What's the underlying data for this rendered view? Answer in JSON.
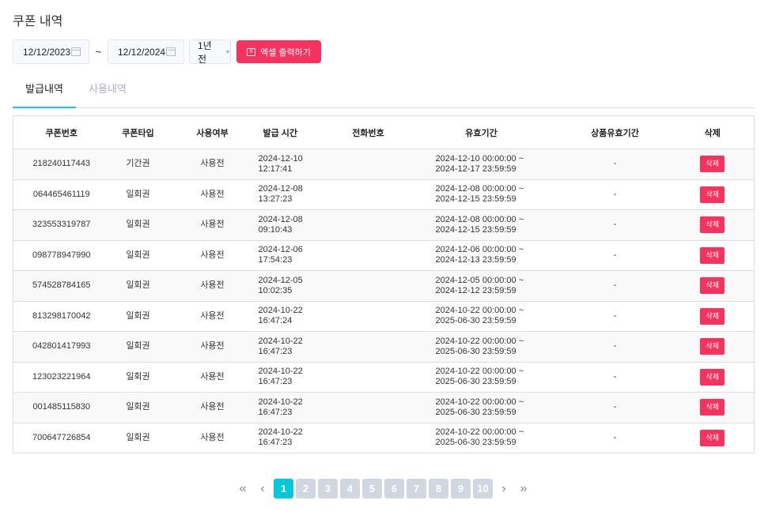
{
  "title": "쿠폰 내역",
  "filters": {
    "start_date": "12/12/2023",
    "separator": "~",
    "end_date": "12/12/2024",
    "period": "1년 전",
    "excel_label": "엑셀 출력하기"
  },
  "tabs": [
    {
      "label": "발급내역",
      "active": true
    },
    {
      "label": "사용내역",
      "active": false
    }
  ],
  "columns": [
    "쿠폰번호",
    "쿠폰타입",
    "사용여부",
    "발급 시간",
    "전화번호",
    "유효기간",
    "상품유효기간",
    "삭제"
  ],
  "rows": [
    {
      "no": "218240117443",
      "type": "기간권",
      "status": "사용전",
      "date": "2024-12-10",
      "time": "12:17:41",
      "phone": "",
      "valid_from": "2024-12-10 00:00:00 ~",
      "valid_to": "2024-12-17 23:59:59",
      "product_valid": "-",
      "del": "삭제"
    },
    {
      "no": "064465461119",
      "type": "일회권",
      "status": "사용전",
      "date": "2024-12-08",
      "time": "13:27:23",
      "phone": "",
      "valid_from": "2024-12-08 00:00:00 ~",
      "valid_to": "2024-12-15 23:59:59",
      "product_valid": "-",
      "del": "삭제"
    },
    {
      "no": "323553319787",
      "type": "일회권",
      "status": "사용전",
      "date": "2024-12-08",
      "time": "09:10:43",
      "phone": "",
      "valid_from": "2024-12-08 00:00:00 ~",
      "valid_to": "2024-12-15 23:59:59",
      "product_valid": "-",
      "del": "삭제"
    },
    {
      "no": "098778947990",
      "type": "일회권",
      "status": "사용전",
      "date": "2024-12-06",
      "time": "17:54:23",
      "phone": "",
      "valid_from": "2024-12-06 00:00:00 ~",
      "valid_to": "2024-12-13 23:59:59",
      "product_valid": "-",
      "del": "삭제"
    },
    {
      "no": "574528784165",
      "type": "일회권",
      "status": "사용전",
      "date": "2024-12-05",
      "time": "10:02:35",
      "phone": "",
      "valid_from": "2024-12-05 00:00:00 ~",
      "valid_to": "2024-12-12 23:59:59",
      "product_valid": "-",
      "del": "삭제"
    },
    {
      "no": "813298170042",
      "type": "일회권",
      "status": "사용전",
      "date": "2024-10-22",
      "time": "16:47:24",
      "phone": "",
      "valid_from": "2024-10-22 00:00:00 ~",
      "valid_to": "2025-06-30 23:59:59",
      "product_valid": "-",
      "del": "삭제"
    },
    {
      "no": "042801417993",
      "type": "일회권",
      "status": "사용전",
      "date": "2024-10-22",
      "time": "16:47:23",
      "phone": "",
      "valid_from": "2024-10-22 00:00:00 ~",
      "valid_to": "2025-06-30 23:59:59",
      "product_valid": "-",
      "del": "삭제"
    },
    {
      "no": "123023221964",
      "type": "일회권",
      "status": "사용전",
      "date": "2024-10-22",
      "time": "16:47:23",
      "phone": "",
      "valid_from": "2024-10-22 00:00:00 ~",
      "valid_to": "2025-06-30 23:59:59",
      "product_valid": "-",
      "del": "삭제"
    },
    {
      "no": "001485115830",
      "type": "일회권",
      "status": "사용전",
      "date": "2024-10-22",
      "time": "16:47:23",
      "phone": "",
      "valid_from": "2024-10-22 00:00:00 ~",
      "valid_to": "2025-06-30 23:59:59",
      "product_valid": "-",
      "del": "삭제"
    },
    {
      "no": "700647726854",
      "type": "일회권",
      "status": "사용전",
      "date": "2024-10-22",
      "time": "16:47:23",
      "phone": "",
      "valid_from": "2024-10-22 00:00:00 ~",
      "valid_to": "2025-06-30 23:59:59",
      "product_valid": "-",
      "del": "삭제"
    }
  ],
  "pagination": {
    "pages": [
      "1",
      "2",
      "3",
      "4",
      "5",
      "6",
      "7",
      "8",
      "9",
      "10"
    ],
    "current": "1",
    "first": "«",
    "prev": "‹",
    "next": "›",
    "last": "»"
  },
  "colors": {
    "accent": "#f7325f",
    "active_tab": "#1ccbd8",
    "active_page": "#06c8d8"
  }
}
